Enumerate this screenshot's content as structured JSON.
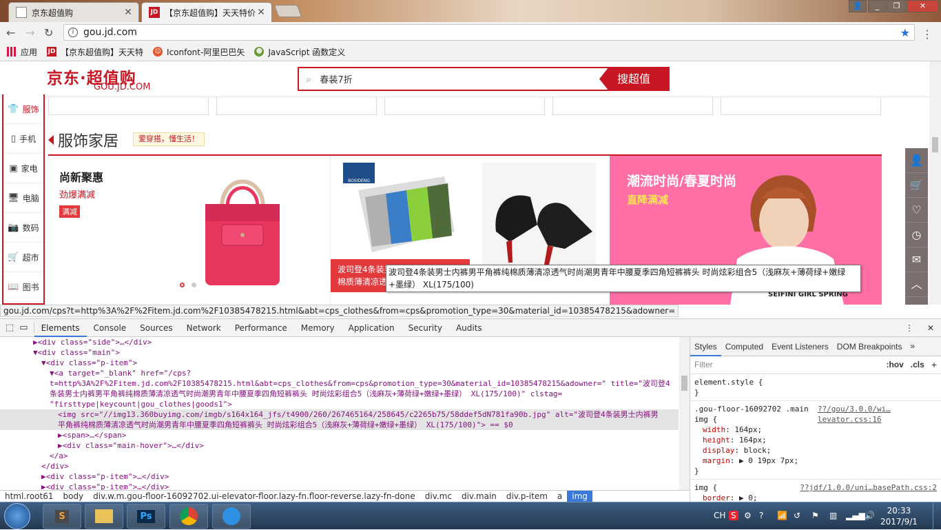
{
  "browser": {
    "tabs": [
      {
        "title": "京东超值购",
        "icon": "page-icon"
      },
      {
        "title": "【京东超值购】天天特价",
        "icon": "jd-icon"
      }
    ],
    "url": "gou.jd.com",
    "bookmarks": [
      {
        "label": "应用",
        "icon": "apps-icon"
      },
      {
        "label": "【京东超值购】天天特",
        "icon": "jd-icon"
      },
      {
        "label": "Iconfont-阿里巴巴矢",
        "icon": "iconfont-icon"
      },
      {
        "label": "JavaScript 函数定义",
        "icon": "js-icon"
      }
    ],
    "status_url": "gou.jd.com/cps?t=http%3A%2F%2Fitem.jd.com%2F10385478215.html&abt=cps_clothes&from=cps&promotion_type=30&material_id=10385478215&adowner="
  },
  "site": {
    "logo_main": "京东·超值购",
    "logo_sub": "GOU.JD.COM",
    "search_value": "春装7折",
    "search_button": "搜超值",
    "sidebar": [
      {
        "label": "服饰",
        "icon": "clothes-icon"
      },
      {
        "label": "手机",
        "icon": "phone-icon"
      },
      {
        "label": "家电",
        "icon": "appliance-icon"
      },
      {
        "label": "电脑",
        "icon": "computer-icon"
      },
      {
        "label": "数码",
        "icon": "camera-icon"
      },
      {
        "label": "超市",
        "icon": "cart-icon"
      },
      {
        "label": "图书",
        "icon": "book-icon"
      }
    ],
    "floor_title": "服饰家居",
    "floor_slogan": "爱穿搭，懂生活！",
    "card1": {
      "title": "尚新聚惠",
      "subtitle": "劲爆满减",
      "badge": "满减"
    },
    "card2": {
      "brand": "BOSIDENG",
      "caption": "波司登4条装男士内裤男平角裤纯棉质薄清凉透"
    },
    "card4": {
      "title": "潮流时尚/春夏时尚",
      "subtitle": "直降满减",
      "shirt_text": "SEIFINI GIRL SPRING"
    },
    "tooltip": "波司登4条装男士内裤男平角裤纯棉质薄清凉透气时尚潮男青年中腰夏季四角短裤裤头 时尚炫彩组合5（浅麻灰+薄荷绿+嫩绿+墨绿） XL(175/100)",
    "rightbar_icons": [
      "user-icon",
      "cart-icon",
      "heart-icon",
      "history-icon",
      "message-icon",
      "top-icon",
      "edit-icon"
    ]
  },
  "devtools": {
    "tabs": [
      "Elements",
      "Console",
      "Sources",
      "Network",
      "Performance",
      "Memory",
      "Application",
      "Security",
      "Audits"
    ],
    "lines": [
      {
        "indent": 4,
        "text": "▶<div class=\"side\">…</div>"
      },
      {
        "indent": 4,
        "text": "▼<div class=\"main\">"
      },
      {
        "indent": 5,
        "text": "▼<div class=\"p-item\">"
      },
      {
        "indent": 6,
        "text": "▼<a target=\"_blank\" href=\"/cps?"
      },
      {
        "indent": 6,
        "text": "t=http%3A%2F%2Fitem.jd.com%2F10385478215.html&abt=cps_clothes&from=cps&promotion_type=30&material_id=10385478215&adowner=\" title=\"波司登4"
      },
      {
        "indent": 6,
        "text": "条装男士内裤男平角裤纯棉质薄清凉透气时尚潮男青年中腰夏季四角短裤裤头 时尚炫彩组合5（浅麻灰+薄荷绿+嫩绿+墨绿） XL(175/100)\" clstag="
      },
      {
        "indent": 6,
        "text": "\"firsttype|keycount|gou_clothes|goods1\">"
      },
      {
        "indent": 7,
        "text": "<img src=\"//img13.360buyimg.com/imgb/s164x164_jfs/t4900/260/267465164/258645/c2265b75/58ddef5dN781fa90b.jpg\" alt=\"波司登4条装男士内裤男"
      },
      {
        "indent": 7,
        "text": "平角裤纯棉质薄清凉透气时尚潮男青年中腰夏季四角短裤裤头 时尚炫彩组合5（浅麻灰+薄荷绿+嫩绿+墨绿） XL(175/100)\"> == $0"
      },
      {
        "indent": 7,
        "text": "▶<span>…</span>"
      },
      {
        "indent": 7,
        "text": "▶<div class=\"main-hover\">…</div>"
      },
      {
        "indent": 6,
        "text": "</a>"
      },
      {
        "indent": 5,
        "text": "</div>"
      },
      {
        "indent": 5,
        "text": "▶<div class=\"p-item\">…</div>"
      },
      {
        "indent": 5,
        "text": "▶<div class=\"p-item\">…</div>"
      }
    ],
    "styles_tabs": [
      "Styles",
      "Computed",
      "Event Listeners",
      "DOM Breakpoints"
    ],
    "filter_placeholder": "Filter",
    "filter_hov": ":hov",
    "filter_cls": ".cls",
    "rules": [
      {
        "selector": "element.style {",
        "source": "",
        "props": [],
        "close": "}"
      },
      {
        "selector": ".gou-floor-16092702 .main img {",
        "source": "??/gou/3.0.0/wi…levator.css:16",
        "props": [
          [
            "width",
            "164px;"
          ],
          [
            "height",
            "164px;"
          ],
          [
            "display",
            "block;"
          ],
          [
            "margin",
            "▶ 0 19px 7px;"
          ]
        ],
        "close": "}"
      },
      {
        "selector": "img {",
        "source": "??jdf/1.0.0/uni…basePath.css:2",
        "props": [
          [
            "border",
            "▶ 0;"
          ],
          [
            "vertical-align",
            "middle;"
          ]
        ],
        "close": ""
      }
    ],
    "breadcrumbs": [
      "html.root61",
      "body",
      "div.w.m.gou-floor-16092702.ui-elevator-floor.lazy-fn.floor-reverse.lazy-fn-done",
      "div.mc",
      "div.main",
      "div.p-item",
      "a",
      "img"
    ]
  },
  "taskbar": {
    "apps": [
      "start-orb-icon",
      "sublime-icon",
      "explorer-icon",
      "photoshop-icon",
      "chrome-icon",
      "feather-icon"
    ],
    "tray_lang": "CH",
    "time": "20:33",
    "date": "2017/9/1"
  },
  "colors": {
    "jd_red": "#c81623",
    "devtools_blue": "#3879d9",
    "promo_pink": "#ff6fa6"
  }
}
